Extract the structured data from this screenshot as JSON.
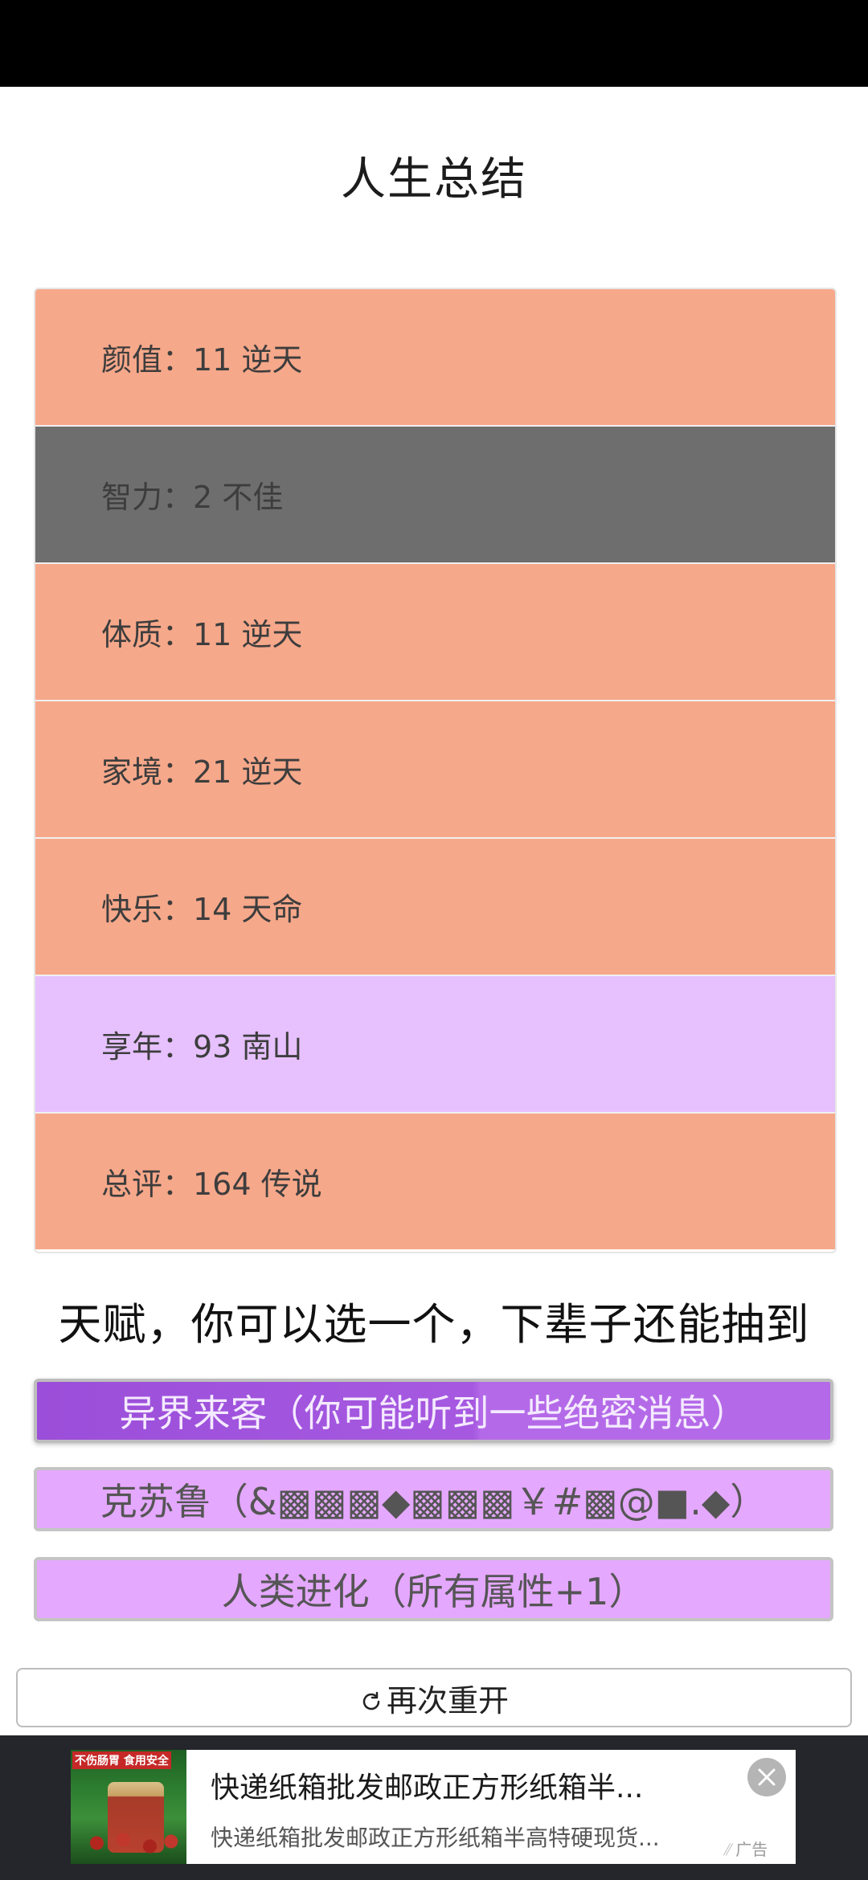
{
  "page": {
    "title": "人生总结"
  },
  "stats": [
    {
      "text": "颜值：11 逆天",
      "color": "#f6a88a"
    },
    {
      "text": "智力：2 不佳",
      "color": "#6e6e6e"
    },
    {
      "text": "体质：11 逆天",
      "color": "#f6a88a"
    },
    {
      "text": "家境：21 逆天",
      "color": "#f6a88a"
    },
    {
      "text": "快乐：14 天命",
      "color": "#f6a88a"
    },
    {
      "text": "享年：93 南山",
      "color": "#e6c1fe"
    },
    {
      "text": "总评：164 传说",
      "color": "#f6a88a"
    }
  ],
  "talents": {
    "heading": "天赋，你可以选一个，下辈子还能抽到",
    "items": [
      {
        "label": "异界来客（你可能听到一些绝密消息）",
        "selected": true
      },
      {
        "label": "克苏鲁（&▩▩▩◆▩▩▩￥#▩@■.◆）",
        "selected": false
      },
      {
        "label": "人类进化（所有属性+1）",
        "selected": false
      }
    ]
  },
  "restart": {
    "label": "再次重开",
    "icon": "refresh-icon"
  },
  "ad": {
    "image_text": "不伤肠胃 食用安全",
    "title": "快递纸箱批发邮政正方形纸箱半...",
    "description": "快递纸箱批发邮政正方形纸箱半高特硬现货...",
    "tag": "广告",
    "close_icon": "close-icon"
  }
}
